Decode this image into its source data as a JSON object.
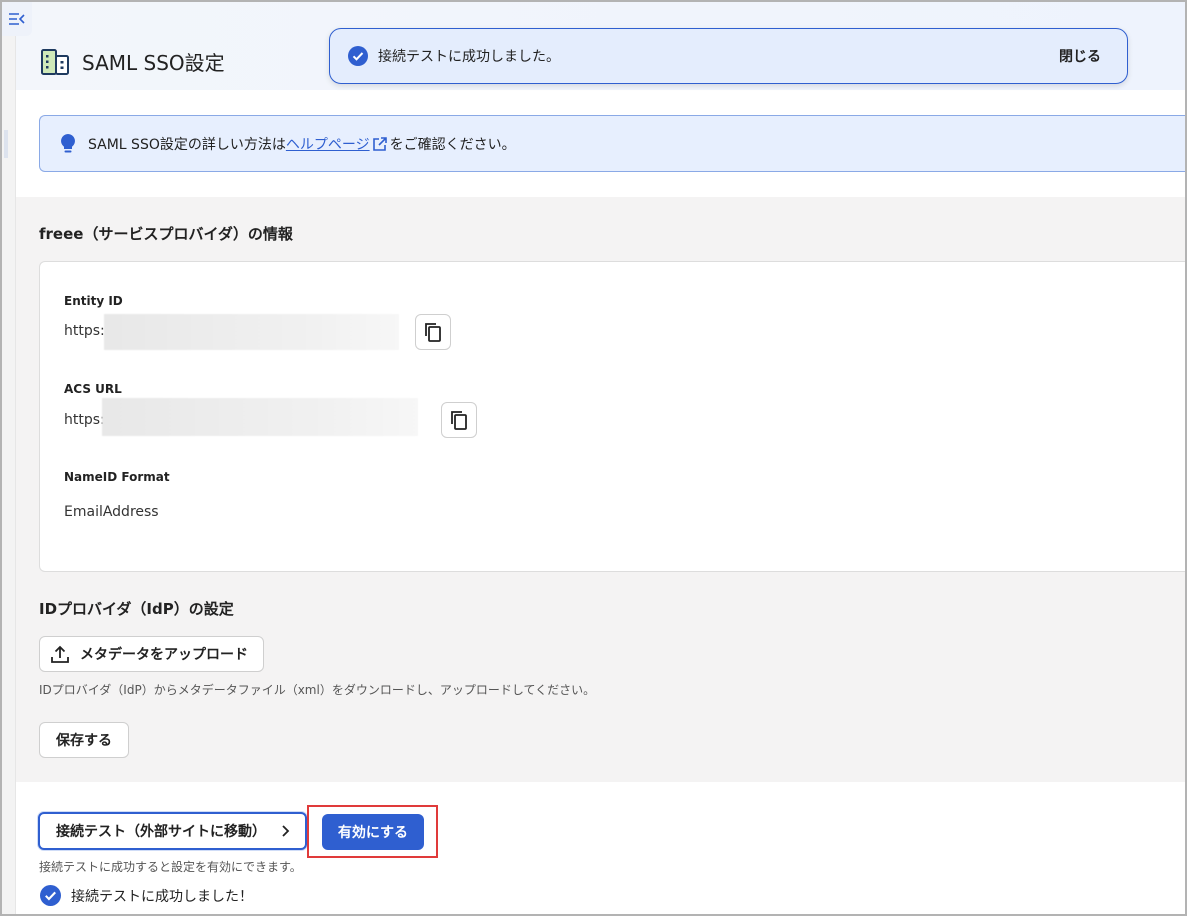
{
  "page": {
    "title": "SAML SSO設定"
  },
  "toast": {
    "message": "接続テストに成功しました。",
    "close_label": "閉じる"
  },
  "info": {
    "prefix": "SAML SSO設定の詳しい方法は",
    "link": "ヘルプページ",
    "suffix": "をご確認ください。"
  },
  "sp_section": {
    "title": "freee（サービスプロバイダ）の情報",
    "entity_id_label": "Entity ID",
    "entity_id_value": "https:/",
    "acs_url_label": "ACS URL",
    "acs_url_value": "https:/",
    "nameid_label": "NameID Format",
    "nameid_value": "EmailAddress"
  },
  "idp_section": {
    "title": "IDプロバイダ（IdP）の設定",
    "upload_label": "メタデータをアップロード",
    "upload_hint": "IDプロバイダ（IdP）からメタデータファイル（xml）をダウンロードし、アップロードしてください。",
    "save_label": "保存する"
  },
  "footer": {
    "test_label": "接続テスト（外部サイトに移動）",
    "enable_label": "有効にする",
    "hint": "接続テストに成功すると設定を有効にできます。",
    "success_message": "接続テストに成功しました！"
  },
  "colors": {
    "primary": "#2f5fd0",
    "highlight": "#e03a3a",
    "toast_bg": "#e4edfd"
  }
}
